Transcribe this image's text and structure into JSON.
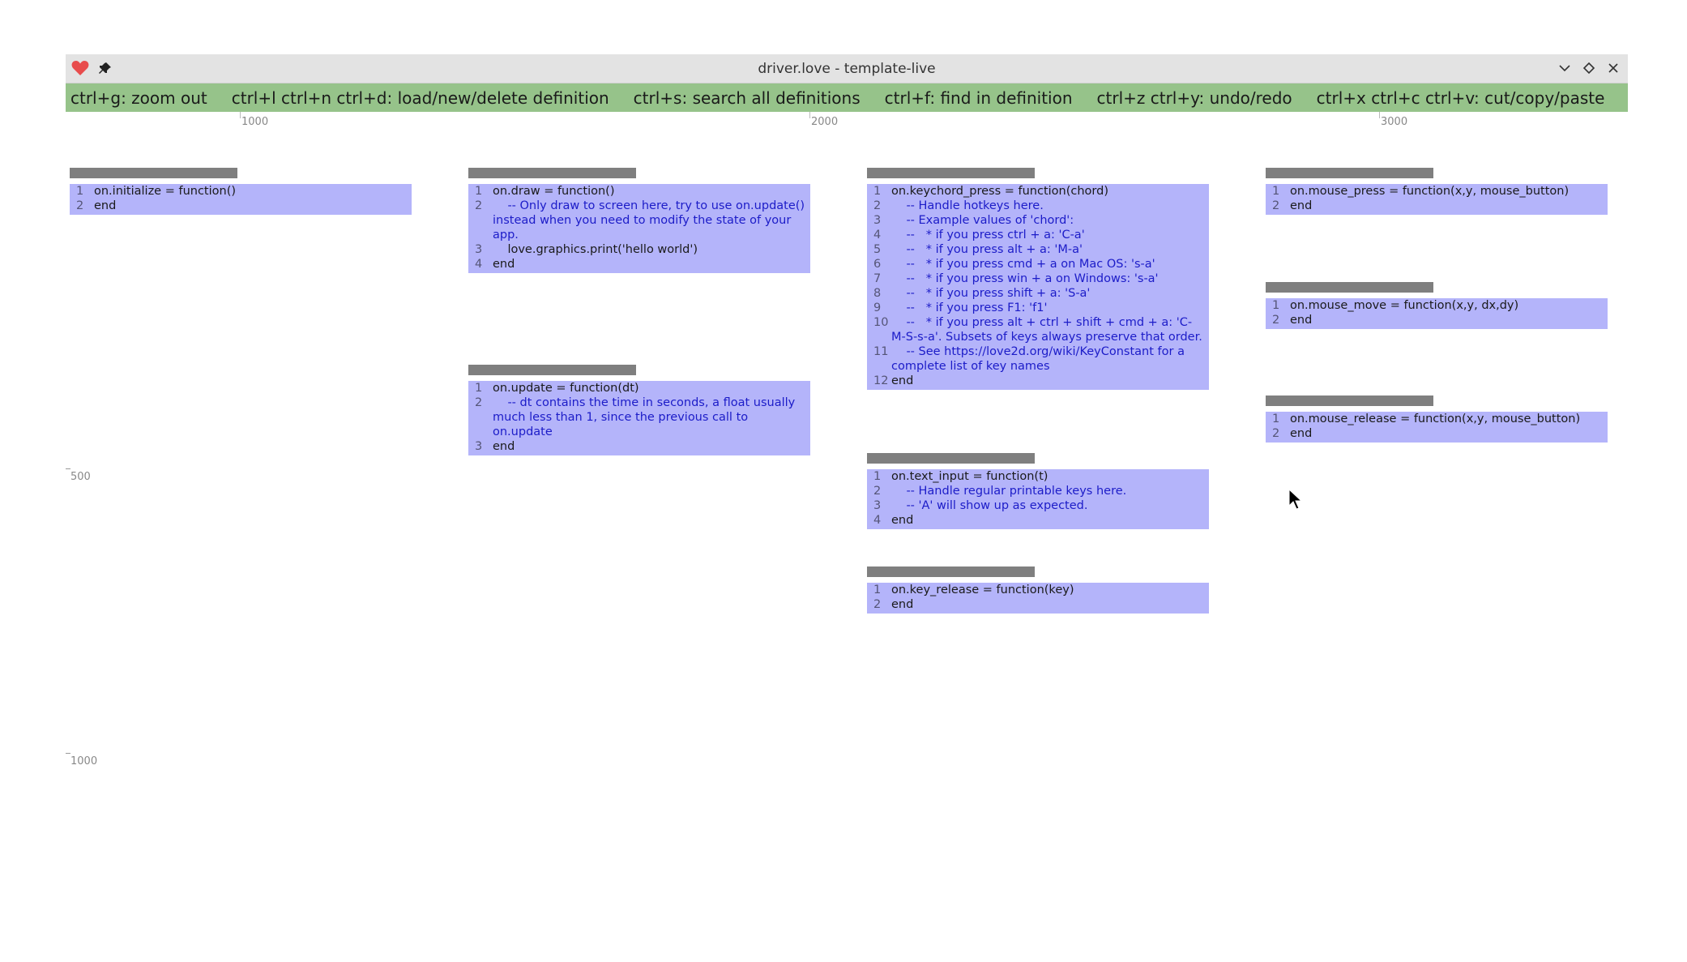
{
  "window": {
    "title": "driver.love - template-live",
    "icons": [
      "heart-icon",
      "pin-icon",
      "chevron-down-icon",
      "diamond-icon",
      "close-icon"
    ]
  },
  "menu": {
    "items": [
      "ctrl+g: zoom out",
      "ctrl+l ctrl+n ctrl+d: load/new/delete definition",
      "ctrl+s: search all definitions",
      "ctrl+f: find in definition",
      "ctrl+z ctrl+y: undo/redo",
      "ctrl+x ctrl+c ctrl+v: cut/copy/paste"
    ]
  },
  "ruler": {
    "horizontal": [
      "1000",
      "2000",
      "3000"
    ],
    "vertical": [
      "500",
      "1000"
    ]
  },
  "cards": [
    {
      "id": "initialize",
      "lines": [
        {
          "n": "1",
          "text": "on.initialize = function()",
          "comment": false
        },
        {
          "n": "2",
          "text": "end",
          "comment": false
        }
      ]
    },
    {
      "id": "draw",
      "lines": [
        {
          "n": "1",
          "text": "on.draw = function()",
          "comment": false
        },
        {
          "n": "2",
          "text": "    -- Only draw to screen here, try to use on.update() instead when you need to modify the state of your app.",
          "comment": true
        },
        {
          "n": "3",
          "text": "    love.graphics.print('hello world')",
          "comment": false
        },
        {
          "n": "4",
          "text": "end",
          "comment": false
        }
      ]
    },
    {
      "id": "update",
      "lines": [
        {
          "n": "1",
          "text": "on.update = function(dt)",
          "comment": false
        },
        {
          "n": "2",
          "text": "    -- dt contains the time in seconds, a float usually much less than 1, since the previous call to on.update",
          "comment": true
        },
        {
          "n": "3",
          "text": "end",
          "comment": false
        }
      ]
    },
    {
      "id": "keychord_press",
      "lines": [
        {
          "n": "1",
          "text": "on.keychord_press = function(chord)",
          "comment": false
        },
        {
          "n": "2",
          "text": "    -- Handle hotkeys here.",
          "comment": true
        },
        {
          "n": "3",
          "text": "    -- Example values of 'chord':",
          "comment": true
        },
        {
          "n": "4",
          "text": "    --   * if you press ctrl + a: 'C-a'",
          "comment": true
        },
        {
          "n": "5",
          "text": "    --   * if you press alt + a: 'M-a'",
          "comment": true
        },
        {
          "n": "6",
          "text": "    --   * if you press cmd + a on Mac OS: 's-a'",
          "comment": true
        },
        {
          "n": "7",
          "text": "    --   * if you press win + a on Windows: 's-a'",
          "comment": true
        },
        {
          "n": "8",
          "text": "    --   * if you press shift + a: 'S-a'",
          "comment": true
        },
        {
          "n": "9",
          "text": "    --   * if you press F1: 'f1'",
          "comment": true
        },
        {
          "n": "10",
          "text": "    --   * if you press alt + ctrl + shift + cmd + a: 'C-M-S-s-a'. Subsets of keys always preserve that order.",
          "comment": true
        },
        {
          "n": "11",
          "text": "    -- See https://love2d.org/wiki/KeyConstant for a complete list of key names",
          "comment": true
        },
        {
          "n": "12",
          "text": "end",
          "comment": false
        }
      ]
    },
    {
      "id": "text_input",
      "lines": [
        {
          "n": "1",
          "text": "on.text_input = function(t)",
          "comment": false
        },
        {
          "n": "2",
          "text": "    -- Handle regular printable keys here.",
          "comment": true
        },
        {
          "n": "3",
          "text": "    -- 'A' will show up as expected.",
          "comment": true
        },
        {
          "n": "4",
          "text": "end",
          "comment": false
        }
      ]
    },
    {
      "id": "key_release",
      "lines": [
        {
          "n": "1",
          "text": "on.key_release = function(key)",
          "comment": false
        },
        {
          "n": "2",
          "text": "end",
          "comment": false
        }
      ]
    },
    {
      "id": "mouse_press",
      "lines": [
        {
          "n": "1",
          "text": "on.mouse_press = function(x,y, mouse_button)",
          "comment": false
        },
        {
          "n": "2",
          "text": "end",
          "comment": false
        }
      ]
    },
    {
      "id": "mouse_move",
      "lines": [
        {
          "n": "1",
          "text": "on.mouse_move = function(x,y, dx,dy)",
          "comment": false
        },
        {
          "n": "2",
          "text": "end",
          "comment": false
        }
      ]
    },
    {
      "id": "mouse_release",
      "lines": [
        {
          "n": "1",
          "text": "on.mouse_release = function(x,y, mouse_button)",
          "comment": false
        },
        {
          "n": "2",
          "text": "end",
          "comment": false
        }
      ]
    }
  ],
  "colors": {
    "menubar": "#96c38a",
    "card_body": "#b4b4fa",
    "card_handle": "#7f7f7f",
    "comment": "#1c1cc8"
  }
}
